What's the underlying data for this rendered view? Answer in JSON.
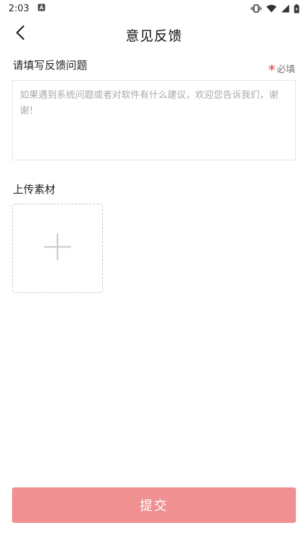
{
  "status_bar": {
    "time": "2:03",
    "icons": [
      "a-icon",
      "vibrate-icon",
      "wifi-icon",
      "signal-icon",
      "battery-charging-icon"
    ]
  },
  "header": {
    "back_icon": "chevron-left-icon",
    "title": "意见反馈"
  },
  "feedback": {
    "label": "请填写反馈问题",
    "required_star": "*",
    "required_text": "必填",
    "placeholder": "如果遇到系统问题或者对软件有什么建议，欢迎您告诉我们，谢谢！",
    "value": ""
  },
  "upload": {
    "label": "上传素材",
    "add_icon": "plus-icon"
  },
  "submit": {
    "label": "提交"
  },
  "colors": {
    "accent": "#f19090",
    "required": "#e03a3a",
    "placeholder": "#a8a8a8"
  }
}
